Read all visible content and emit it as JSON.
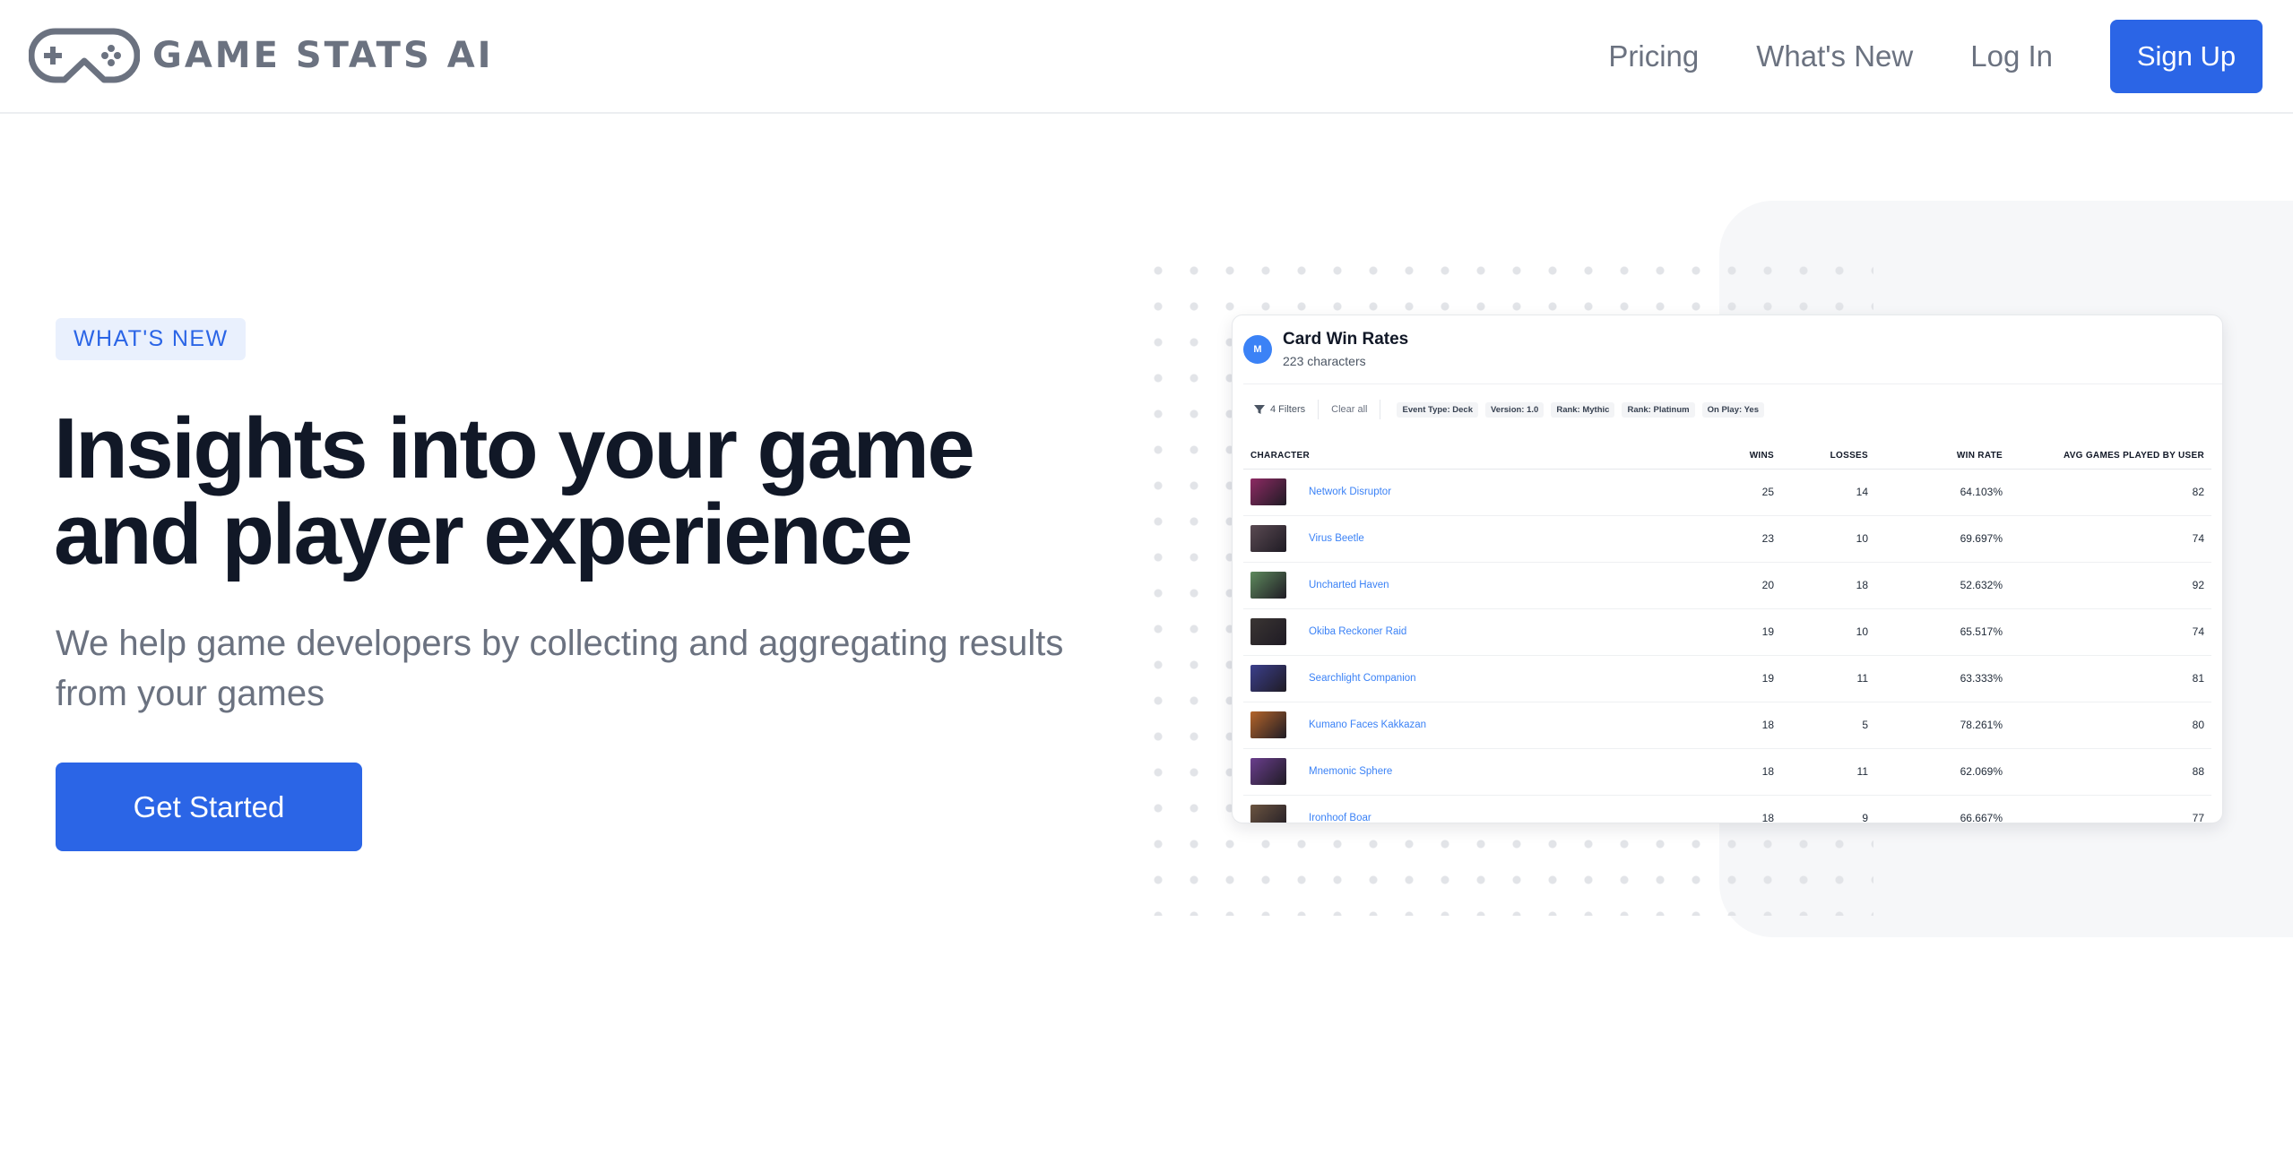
{
  "brand": {
    "name": "GAME STATS AI",
    "color": "#6b7280"
  },
  "nav": {
    "links": [
      {
        "label": "Pricing"
      },
      {
        "label": "What's New"
      },
      {
        "label": "Log In"
      }
    ],
    "signup_label": "Sign Up"
  },
  "hero": {
    "badge": "WHAT'S NEW",
    "headline_line1": "Insights into your game",
    "headline_line2": "and player experience",
    "subtext": "We help game developers by collecting and aggregating results from your games",
    "cta_label": "Get Started"
  },
  "card": {
    "avatar_letter": "M",
    "title": "Card Win Rates",
    "subtitle": "223 characters",
    "filter_label": "4 Filters",
    "clear_label": "Clear all",
    "chips": [
      "Event Type: Deck",
      "Version: 1.0",
      "Rank: Mythic",
      "Rank: Platinum",
      "On Play: Yes"
    ],
    "columns": [
      "CHARACTER",
      "WINS",
      "LOSSES",
      "WIN RATE",
      "AVG GAMES PLAYED BY USER"
    ],
    "rows": [
      {
        "name": "Network Disruptor",
        "wins": "25",
        "losses": "14",
        "win_rate": "64.103%",
        "avg": "82"
      },
      {
        "name": "Virus Beetle",
        "wins": "23",
        "losses": "10",
        "win_rate": "69.697%",
        "avg": "74"
      },
      {
        "name": "Uncharted Haven",
        "wins": "20",
        "losses": "18",
        "win_rate": "52.632%",
        "avg": "92"
      },
      {
        "name": "Okiba Reckoner Raid",
        "wins": "19",
        "losses": "10",
        "win_rate": "65.517%",
        "avg": "74"
      },
      {
        "name": "Searchlight Companion",
        "wins": "19",
        "losses": "11",
        "win_rate": "63.333%",
        "avg": "81"
      },
      {
        "name": "Kumano Faces Kakkazan",
        "wins": "18",
        "losses": "5",
        "win_rate": "78.261%",
        "avg": "80"
      },
      {
        "name": "Mnemonic Sphere",
        "wins": "18",
        "losses": "11",
        "win_rate": "62.069%",
        "avg": "88"
      },
      {
        "name": "Ironhoof Boar",
        "wins": "18",
        "losses": "9",
        "win_rate": "66.667%",
        "avg": "77"
      }
    ]
  },
  "colors": {
    "accent": "#2b65e6",
    "link": "#3b82f6",
    "badge_bg": "#e9f0fd",
    "thumbnails": [
      "#8d2a63",
      "#5a4a52",
      "#5e8a5d",
      "#3a3533",
      "#3b3f8c",
      "#b5652a",
      "#6a3e8d",
      "#6b5440"
    ]
  }
}
